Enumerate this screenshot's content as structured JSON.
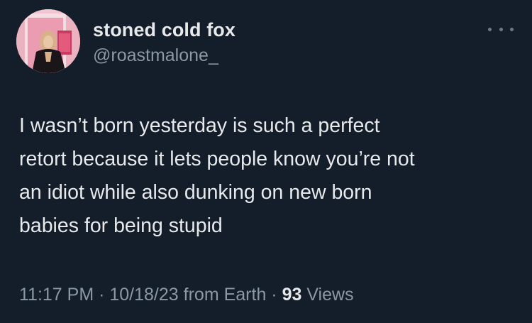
{
  "user": {
    "display_name": "stoned cold fox",
    "handle": "@roastmalone_",
    "avatar_icon": "profile-photo"
  },
  "menu": {
    "icon": "more-icon"
  },
  "tweet": {
    "lines": [
      "I wasn’t born yesterday is such a perfect",
      "retort because it lets people know you’re not",
      "an idiot while also dunking on new born",
      "babies for being stupid"
    ]
  },
  "meta": {
    "time": "11:17 PM",
    "sep1": " · ",
    "date": "10/18/23",
    "source": " from Earth",
    "sep2": " · ",
    "views_count": "93",
    "views_label": " Views"
  },
  "colors": {
    "background": "#141d2a",
    "text": "#e7e9ea",
    "secondary": "#8b98a5"
  }
}
